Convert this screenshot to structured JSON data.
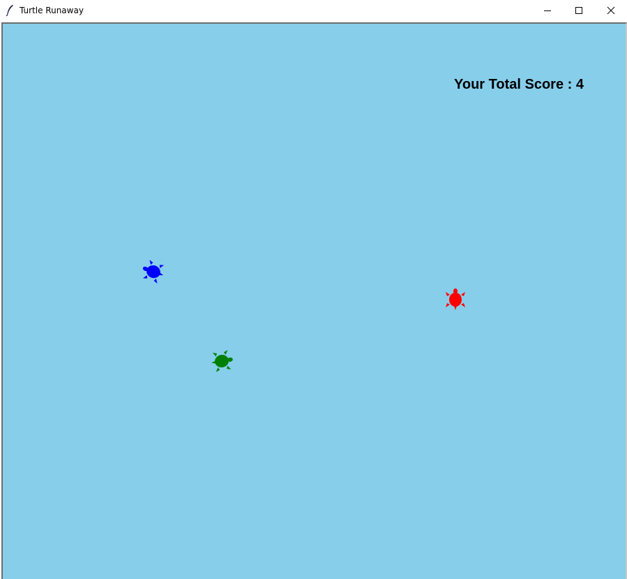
{
  "window": {
    "title": "Turtle Runaway"
  },
  "titlebar_icons": {
    "app_icon": "feather-icon",
    "minimize": "minimize-icon",
    "maximize": "maximize-icon",
    "close": "close-icon"
  },
  "canvas": {
    "background_color": "#87ceeb"
  },
  "score": {
    "label": "Your Total Score : 4",
    "value": 4
  },
  "turtles": [
    {
      "name": "blue-turtle",
      "color": "#0000ff"
    },
    {
      "name": "green-turtle",
      "color": "#008000"
    },
    {
      "name": "red-turtle",
      "color": "#ff0000"
    }
  ]
}
